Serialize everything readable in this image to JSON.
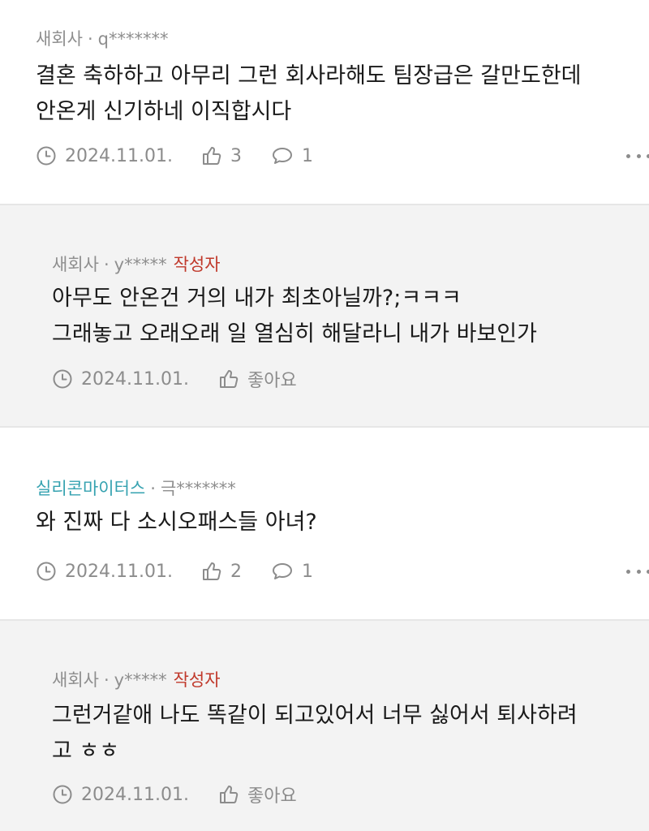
{
  "comments": [
    {
      "company": "새회사",
      "user": "q*******",
      "lines": [
        "결혼 축하하고 아무리 그런 회사라해도 팀장급은 갈만도한데",
        "안온게 신기하네 이직합시다"
      ],
      "date": "2024.11.01.",
      "likes": "3",
      "replies": "1"
    },
    {
      "company": "새회사",
      "user": "y*****",
      "author_tag": "작성자",
      "lines": [
        "아무도 안온건 거의 내가 최초아닐까?;ㅋㅋㅋ",
        "그래놓고 오래오래 일 열심히 해달라니 내가 바보인가"
      ],
      "date": "2024.11.01.",
      "like_label": "좋아요"
    },
    {
      "company": "실리콘마이터스",
      "user": "극*******",
      "lines": [
        "와 진짜 다 소시오패스들 아녀?"
      ],
      "date": "2024.11.01.",
      "likes": "2",
      "replies": "1"
    },
    {
      "company": "새회사",
      "user": "y*****",
      "author_tag": "작성자",
      "lines": [
        "그런거같애 나도 똑같이 되고있어서 너무 싫어서 퇴사하려",
        "고 ㅎㅎ"
      ],
      "date": "2024.11.01.",
      "like_label": "좋아요"
    }
  ],
  "meta_separator": "·",
  "icons": {
    "clock": "clock-icon",
    "like": "thumbs-up-icon",
    "reply": "speech-bubble-icon",
    "more": "more-dots-icon"
  },
  "colors": {
    "accent_company": "#35a2b0",
    "author_tag": "#c0392b",
    "reply_bg": "#f3f3f3",
    "muted": "#8c8c8c"
  }
}
